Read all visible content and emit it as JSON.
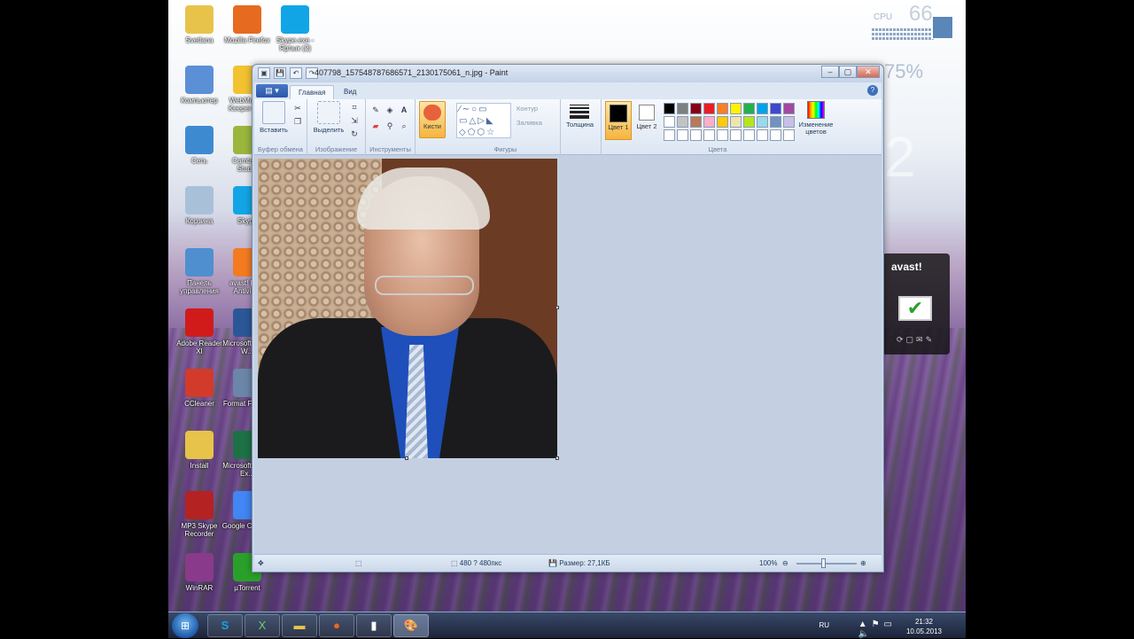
{
  "desktop": {
    "icons": [
      {
        "label": "Svetlana",
        "icon": "folder-icon",
        "color": "#e8c34a"
      },
      {
        "label": "Mozilla Firefox",
        "icon": "firefox-icon",
        "color": "#e66a1f"
      },
      {
        "label": "Skype.exe - Ярлык (2)",
        "icon": "skype-icon",
        "color": "#12a5e6"
      },
      {
        "label": "Компьютер",
        "icon": "computer-icon",
        "color": "#5b8fd6"
      },
      {
        "label": "WebMoney Keeper Cl...",
        "icon": "webmoney-icon",
        "color": "#f2c230"
      },
      {
        "label": "Сеть",
        "icon": "network-icon",
        "color": "#3d8ad1"
      },
      {
        "label": "Camtasia Studio",
        "icon": "camtasia-icon",
        "color": "#9ab63d"
      },
      {
        "label": "Корзина",
        "icon": "recycle-bin-icon",
        "color": "#a9c0d9"
      },
      {
        "label": "Skype",
        "icon": "skype-icon",
        "color": "#12a5e6"
      },
      {
        "label": "Панель управления",
        "icon": "control-panel-icon",
        "color": "#4f8fd0"
      },
      {
        "label": "avast! Free Antivirus",
        "icon": "avast-icon",
        "color": "#f47a20"
      },
      {
        "label": "Adobe Reader XI",
        "icon": "adobe-reader-icon",
        "color": "#d11b1b"
      },
      {
        "label": "Microsoft Office W...",
        "icon": "word-icon",
        "color": "#2b5797"
      },
      {
        "label": "CCleaner",
        "icon": "ccleaner-icon",
        "color": "#d23b2a"
      },
      {
        "label": "Format Factory",
        "icon": "format-factory-icon",
        "color": "#6b86a8"
      },
      {
        "label": "Install",
        "icon": "folder-icon",
        "color": "#e8c34a"
      },
      {
        "label": "Microsoft Office Ex...",
        "icon": "excel-icon",
        "color": "#1e7145"
      },
      {
        "label": "MP3 Skype Recorder",
        "icon": "mp3-skype-recorder-icon",
        "color": "#b52222"
      },
      {
        "label": "Google Chrome",
        "icon": "chrome-icon",
        "color": "#4285f4"
      },
      {
        "label": "WinRAR",
        "icon": "winrar-icon",
        "color": "#8a3a8a"
      },
      {
        "label": "µTorrent",
        "icon": "utorrent-icon",
        "color": "#2aa02a"
      }
    ]
  },
  "gadgets": {
    "cpu_label": "CPU",
    "cpu_value": "66",
    "mem_value": "75%",
    "clock_digit": "2",
    "avast_brand": "avast!",
    "avast_tools": "⟳▢✉✎"
  },
  "paint": {
    "title": "407798_1575487876865​71_2130175061_n.jpg - Paint",
    "qat": [
      "▣",
      "💾",
      "↶",
      "↷"
    ],
    "tabs": {
      "menu": "▤ ▾",
      "home": "Главная",
      "view": "Вид"
    },
    "help": "?",
    "ribbon": {
      "clipboard": {
        "paste": "Вставить",
        "label": "Буфер обмена"
      },
      "image": {
        "select": "Выделить",
        "label": "Изображение"
      },
      "tools": {
        "label": "Инструменты"
      },
      "brushes": {
        "label": "Кисти"
      },
      "shapes": {
        "label": "Фигуры",
        "outline": "Контур",
        "fill": "Заливка"
      },
      "thickness": {
        "label": "Толщина"
      },
      "colors": {
        "color1": "Цвет 1",
        "color2": "Цвет 2",
        "edit": "Изменение цветов",
        "label": "Цвета",
        "palette": [
          "#000000",
          "#7f7f7f",
          "#880015",
          "#ed1c24",
          "#ff7f27",
          "#fff200",
          "#22b14c",
          "#00a2e8",
          "#3f48cc",
          "#a349a4",
          "#ffffff",
          "#c3c3c3",
          "#b97a57",
          "#ffaec9",
          "#ffc90e",
          "#efe4b0",
          "#b5e61d",
          "#99d9ea",
          "#7092be",
          "#c8bfe7",
          "#ffffff",
          "#ffffff",
          "#ffffff",
          "#ffffff",
          "#ffffff",
          "#ffffff",
          "#ffffff",
          "#ffffff",
          "#ffffff",
          "#ffffff"
        ]
      }
    },
    "status": {
      "dimensions": "480 ? 480пкс",
      "size": "Размер: 27,1КБ",
      "zoom": "100%"
    }
  },
  "taskbar": {
    "lang": "RU",
    "time": "21:32",
    "date": "10.05.2013",
    "tray_icons": "▲⚑▭🔈"
  }
}
